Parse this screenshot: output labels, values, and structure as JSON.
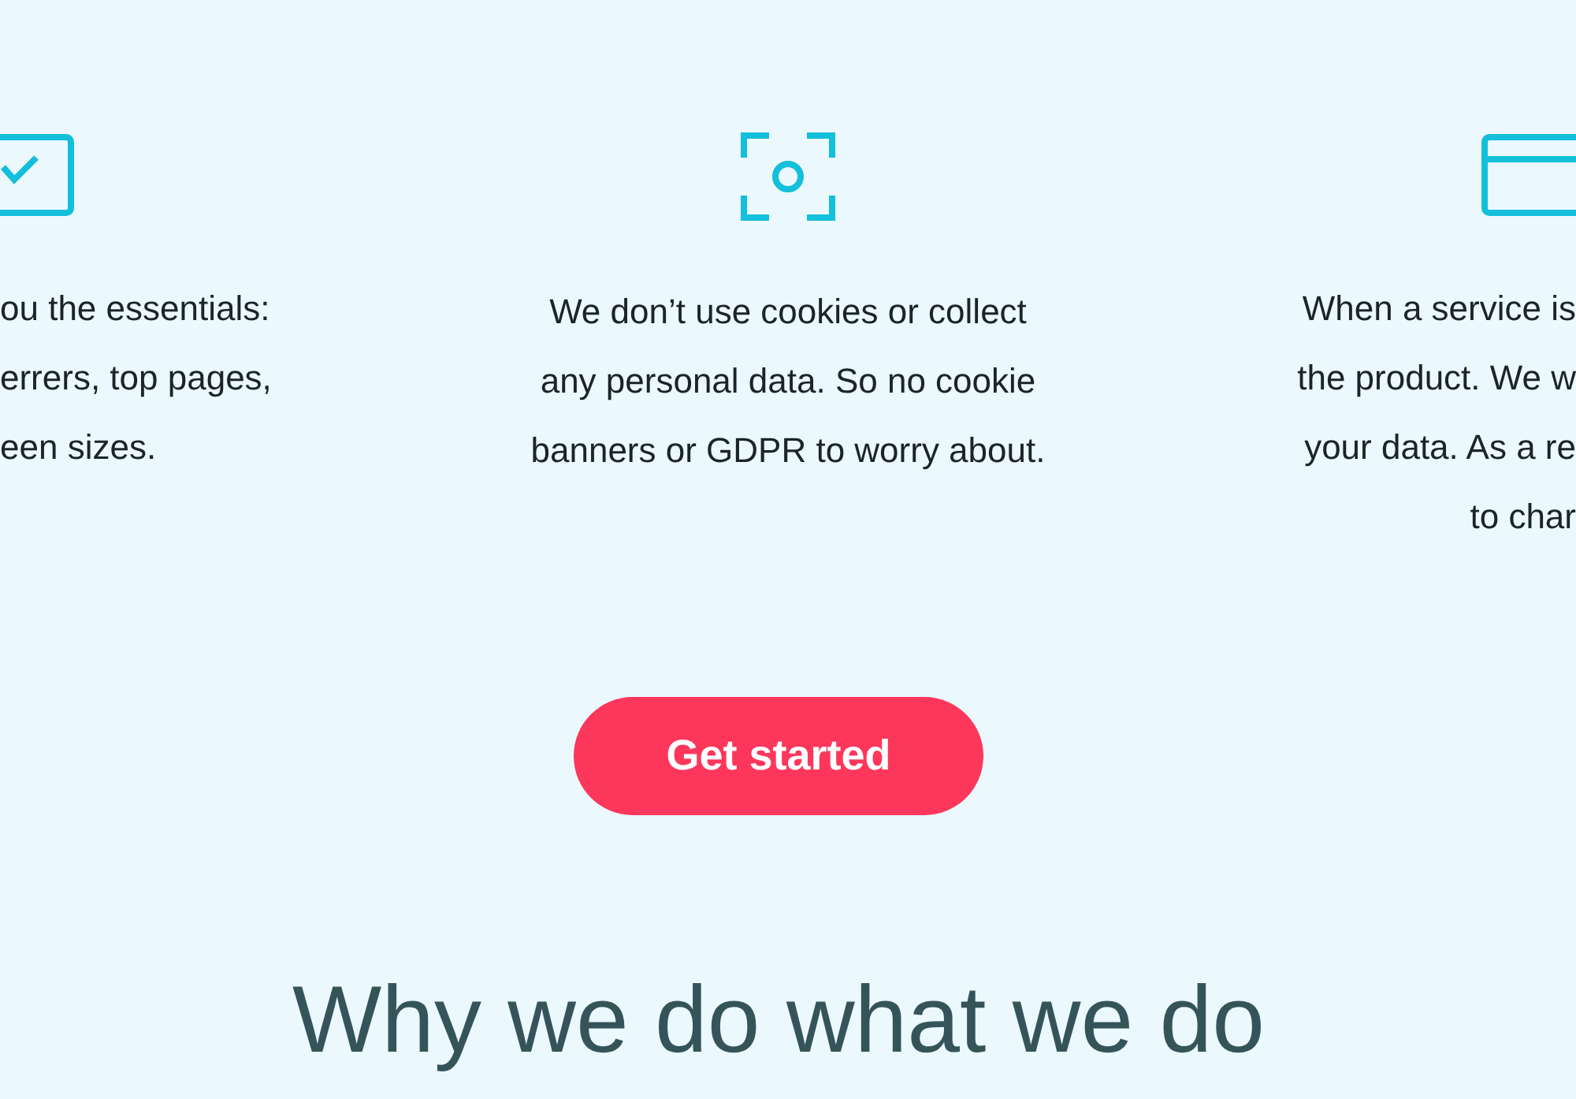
{
  "features": [
    {
      "kind": "check",
      "lines": [
        "ou the essentials:",
        "errers, top pages,",
        "een sizes."
      ]
    },
    {
      "kind": "focus",
      "lines": [
        "We don’t use cookies or collect",
        "any personal data. So no cookie",
        "banners or GDPR to worry about."
      ]
    },
    {
      "kind": "card",
      "lines": [
        "When a service is",
        "the product. We w",
        "your data. As a re",
        "to char"
      ]
    }
  ],
  "cta": {
    "label": "Get started"
  },
  "heading": "Why we do what we do"
}
